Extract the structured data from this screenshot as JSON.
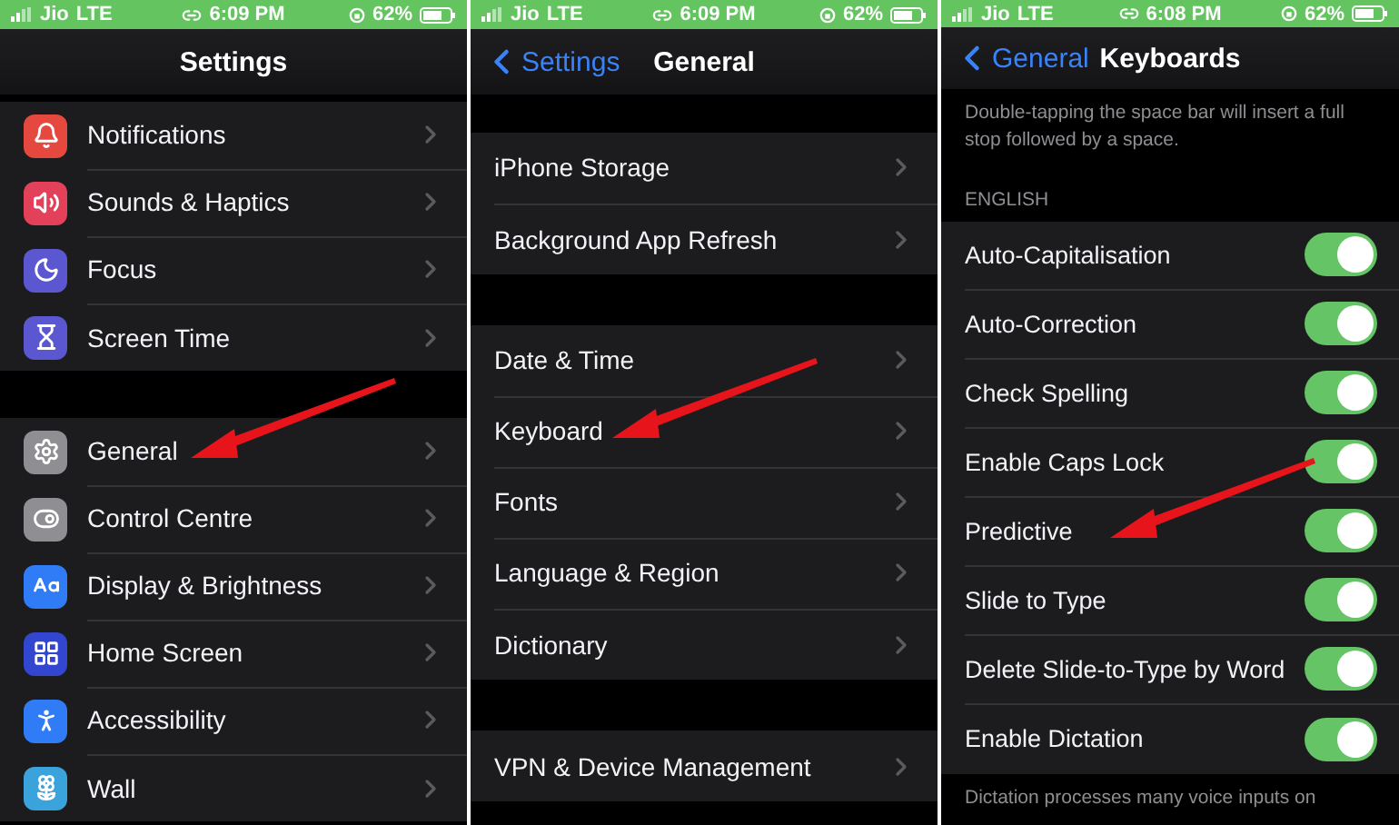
{
  "panels": [
    {
      "status_bar": {
        "carrier": "Jio",
        "network": "LTE",
        "time": "6:09 PM",
        "battery": "62%"
      },
      "nav": {
        "title": "Settings"
      },
      "sections": [
        {
          "items": [
            {
              "label": "Notifications",
              "color": "#e5483f",
              "pointed": false
            },
            {
              "label": "Sounds & Haptics",
              "color": "#e3405a",
              "pointed": false
            },
            {
              "label": "Focus",
              "color": "#5b57d1",
              "pointed": false
            },
            {
              "label": "Screen Time",
              "color": "#5b57d1",
              "pointed": false
            }
          ]
        },
        {
          "items": [
            {
              "label": "General",
              "color": "#8e8e93",
              "pointed": true
            },
            {
              "label": "Control Centre",
              "color": "#8e8e93",
              "pointed": false
            },
            {
              "label": "Display & Brightness",
              "color": "#2f7cf6",
              "pointed": false
            },
            {
              "label": "Home Screen",
              "color": "#3346cf",
              "pointed": false
            },
            {
              "label": "Accessibility",
              "color": "#2f7cf6",
              "pointed": false
            },
            {
              "label": "Wall",
              "color": "#3aa3dc",
              "pointed": false
            }
          ]
        }
      ]
    },
    {
      "status_bar": {
        "carrier": "Jio",
        "network": "LTE",
        "time": "6:09 PM",
        "battery": "62%"
      },
      "nav": {
        "back": "Settings",
        "title": "General"
      },
      "sections": [
        {
          "items": [
            {
              "label": "iPhone Storage",
              "pointed": false
            },
            {
              "label": "Background App Refresh",
              "pointed": false
            }
          ]
        },
        {
          "items": [
            {
              "label": "Date & Time",
              "pointed": false
            },
            {
              "label": "Keyboard",
              "pointed": true
            },
            {
              "label": "Fonts",
              "pointed": false
            },
            {
              "label": "Language & Region",
              "pointed": false
            },
            {
              "label": "Dictionary",
              "pointed": false
            }
          ]
        },
        {
          "items": [
            {
              "label": "VPN & Device Management",
              "pointed": false
            }
          ]
        }
      ]
    },
    {
      "status_bar": {
        "carrier": "Jio",
        "network": "LTE",
        "time": "6:08 PM",
        "battery": "62%"
      },
      "nav": {
        "back": "General",
        "title": "Keyboards"
      },
      "sections": [
        {
          "footer": "Double-tapping the space bar will insert a full stop followed by a space."
        },
        {
          "header": "ENGLISH",
          "items": [
            {
              "label": "Auto-Capitalisation",
              "on": true,
              "pointed": false
            },
            {
              "label": "Auto-Correction",
              "on": true,
              "pointed": false
            },
            {
              "label": "Check Spelling",
              "on": true,
              "pointed": false
            },
            {
              "label": "Enable Caps Lock",
              "on": true,
              "pointed": false
            },
            {
              "label": "Predictive",
              "on": true,
              "pointed": true
            },
            {
              "label": "Slide to Type",
              "on": true,
              "pointed": false
            },
            {
              "label": "Delete Slide-to-Type by Word",
              "on": true,
              "pointed": false
            },
            {
              "label": "Enable Dictation",
              "on": true,
              "pointed": false
            }
          ],
          "footer": "Dictation processes many voice inputs on"
        }
      ]
    }
  ]
}
